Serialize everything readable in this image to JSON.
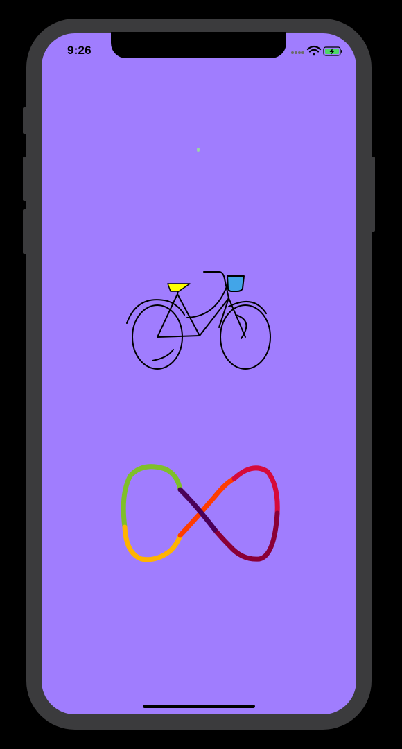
{
  "status_bar": {
    "time": "9:26",
    "signal_icon": "signal-dots-icon",
    "wifi_icon": "wifi-icon",
    "battery_icon": "battery-charging-icon"
  },
  "screen": {
    "background_color": "#a07dfe"
  },
  "loading_indicator": {
    "color": "#9ad3a7"
  },
  "bicycle": {
    "icon": "bicycle-icon",
    "line_color": "#000000",
    "seat_color": "#ffff00",
    "basket_color": "#42a5e8"
  },
  "infinity": {
    "icon": "infinity-icon",
    "segment_colors": [
      "#7fbf2a",
      "#ffb300",
      "#ff3d00",
      "#d60a3a",
      "#8a0036",
      "#4a0058"
    ]
  },
  "colors": {
    "frame": "#3b3b3d",
    "battery_fill": "#4cd964"
  }
}
